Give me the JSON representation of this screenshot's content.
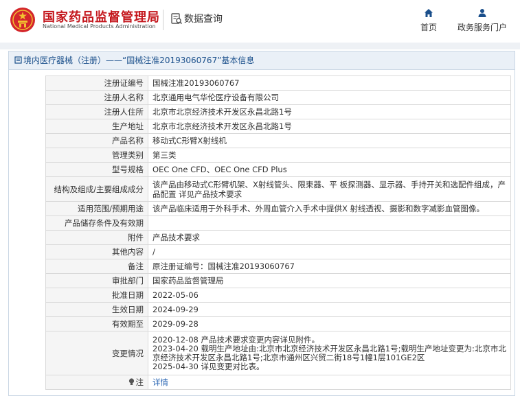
{
  "header": {
    "brand_cn": "国家药品监督管理局",
    "brand_en": "National Medical Products Administration",
    "section_title": "数据查询",
    "nav": [
      {
        "label": "首页",
        "icon": "home-icon"
      },
      {
        "label": "政务服务门户",
        "icon": "user-icon"
      }
    ],
    "colors": {
      "brand": "#c4161c",
      "accent": "#1a4f8b"
    }
  },
  "panel": {
    "title": "境内医疗器械（注册）——“国械注准20193060767”基本信息"
  },
  "fields": [
    {
      "key": "注册证编号",
      "value": "国械注准20193060767"
    },
    {
      "key": "注册人名称",
      "value": "北京通用电气华伦医疗设备有限公司"
    },
    {
      "key": "注册人住所",
      "value": "北京市北京经济技术开发区永昌北路1号"
    },
    {
      "key": "生产地址",
      "value": "北京市北京经济技术开发区永昌北路1号"
    },
    {
      "key": "产品名称",
      "value": "移动式C形臂X射线机"
    },
    {
      "key": "管理类别",
      "value": "第三类"
    },
    {
      "key": "型号规格",
      "value": "OEC One CFD、OEC One CFD Plus"
    },
    {
      "key": "结构及组成/主要组成成分",
      "value": "该产品由移动式C形臂机架、X射线管头、限束器、平 板探测器、显示器、手持开关和选配件组成，产品配置 详见产品技术要求"
    },
    {
      "key": "适用范围/预期用途",
      "value": "该产品临床适用于外科手术、外周血管介入手术中提供X 射线透视、摄影和数字减影血管图像。"
    },
    {
      "key": "产品储存条件及有效期",
      "value": ""
    },
    {
      "key": "附件",
      "value": "产品技术要求"
    },
    {
      "key": "其他内容",
      "value": "/"
    },
    {
      "key": "备注",
      "value": "原注册证编号：国械注准20193060767"
    },
    {
      "key": "审批部门",
      "value": "国家药品监督管理局"
    },
    {
      "key": "批准日期",
      "value": "2022-05-06"
    },
    {
      "key": "生效日期",
      "value": "2024-09-29"
    },
    {
      "key": "有效期至",
      "value": "2029-09-28"
    }
  ],
  "changes": {
    "key": "变更情况",
    "lines": [
      "2020-12-08 产品技术要求变更内容详见附件。",
      "2023-04-20 载明生产地址由:北京市北京经济技术开发区永昌北路1号;载明生产地址变更为:北京市北京经济技术开发区永昌北路1号;北京市通州区兴贸二街18号1幢1层101GE2区",
      "2025-04-30 详见变更对比表。"
    ]
  },
  "note": {
    "key": "注",
    "link": "详情"
  }
}
